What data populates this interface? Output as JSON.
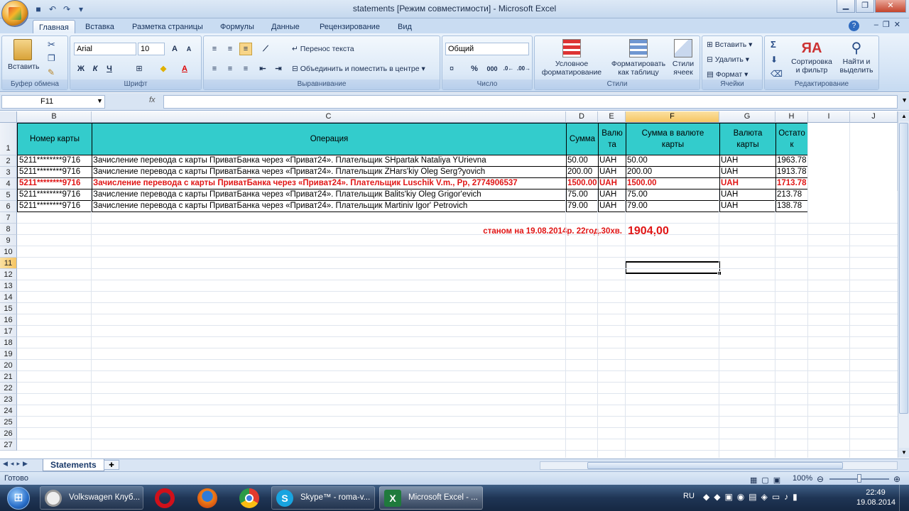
{
  "window": {
    "title": "statements  [Режим совместимости] - Microsoft Excel",
    "minimize": "▁",
    "restore": "❐",
    "close": "✕"
  },
  "ribbon": {
    "tabs": [
      "Главная",
      "Вставка",
      "Разметка страницы",
      "Формулы",
      "Данные",
      "Рецензирование",
      "Вид"
    ],
    "clipboard": {
      "paste": "Вставить",
      "label": "Буфер обмена"
    },
    "font": {
      "name": "Arial",
      "size": "10",
      "bold": "Ж",
      "italic": "К",
      "underline": "Ч",
      "label": "Шрифт"
    },
    "alignment": {
      "wrap": "Перенос текста",
      "merge": "Объединить и поместить в центре",
      "label": "Выравнивание"
    },
    "number": {
      "format": "Общий",
      "percent": "%",
      "thousands": "000",
      "label": "Число"
    },
    "styles": {
      "conditional_1": "Условное",
      "conditional_2": "форматирование",
      "astable_1": "Форматировать",
      "astable_2": "как таблицу",
      "cellstyles_1": "Стили",
      "cellstyles_2": "ячеек",
      "label": "Стили"
    },
    "cells": {
      "insert": "Вставить",
      "delete": "Удалить",
      "format": "Формат",
      "label": "Ячейки"
    },
    "editing": {
      "sort_1": "Сортировка",
      "sort_2": "и фильтр",
      "find_1": "Найти и",
      "find_2": "выделить",
      "label": "Редактирование"
    }
  },
  "formula": {
    "name_box": "F11",
    "fx": "fx",
    "value": ""
  },
  "columns": [
    "B",
    "C",
    "D",
    "E",
    "F",
    "G",
    "H",
    "I",
    "J"
  ],
  "rows": [
    "1",
    "2",
    "3",
    "4",
    "5",
    "6",
    "7",
    "8",
    "9",
    "10",
    "11",
    "12",
    "13",
    "14",
    "15",
    "16",
    "17",
    "18",
    "19",
    "20",
    "21",
    "22",
    "23",
    "24",
    "25",
    "26",
    "27"
  ],
  "table": {
    "headers": {
      "card": "Номер карты",
      "operation": "Операция",
      "amount": "Сумма",
      "currency_1": "Валю",
      "currency_2": "та",
      "card_amount_1": "Сумма в валюте",
      "card_amount_2": "карты",
      "card_currency_1": "Валюта",
      "card_currency_2": "карты",
      "balance_1": "Остато",
      "balance_2": "к"
    },
    "rows": [
      {
        "card": "5211********9716",
        "operation": "Зачисление перевода с карты ПриватБанка через «Приват24». Плательщик SHpartak Nataliya YUrievna",
        "amount": "50.00",
        "currency": "UAH",
        "card_amount": "50.00",
        "card_currency": "UAH",
        "balance": "1963.78"
      },
      {
        "card": "5211********9716",
        "operation": "Зачисление перевода с карты ПриватБанка через «Приват24». Плательщик ZHars'kiy Oleg Serg?yovich",
        "amount": "200.00",
        "currency": "UAH",
        "card_amount": "200.00",
        "card_currency": "UAH",
        "balance": "1913.78"
      },
      {
        "card": "5211********9716",
        "operation": "Зачисление перевода с карты ПриватБанка через «Приват24». Плательщик Luschik V.m., Рр, 2774906537",
        "amount": "1500.00",
        "currency": "UAH",
        "card_amount": "1500.00",
        "card_currency": "UAH",
        "balance": "1713.78"
      },
      {
        "card": "5211********9716",
        "operation": "Зачисление перевода с карты ПриватБанка через «Приват24». Плательщик Balits'kiy Oleg Grigor'evich",
        "amount": "75.00",
        "currency": "UAH",
        "card_amount": "75.00",
        "card_currency": "UAH",
        "balance": "213.78"
      },
      {
        "card": "5211********9716",
        "operation": "Зачисление перевода с карты ПриватБанка через «Приват24». Плательщик Martiniv Igor' Petrovich",
        "amount": "79.00",
        "currency": "UAH",
        "card_amount": "79.00",
        "card_currency": "UAH",
        "balance": "138.78"
      }
    ]
  },
  "note": {
    "text": "станом на 19.08.2014р. 22год.30хв.",
    "total": "1904,00"
  },
  "sheet": {
    "tab": "Statements"
  },
  "status": {
    "ready": "Готово",
    "zoom": "100%"
  },
  "taskbar": {
    "apps": [
      "Volkswagen Клуб...",
      "Skype™ - roma-v...",
      "Microsoft Excel - ..."
    ],
    "lang": "RU",
    "time": "22:49",
    "date": "19.08.2014"
  }
}
